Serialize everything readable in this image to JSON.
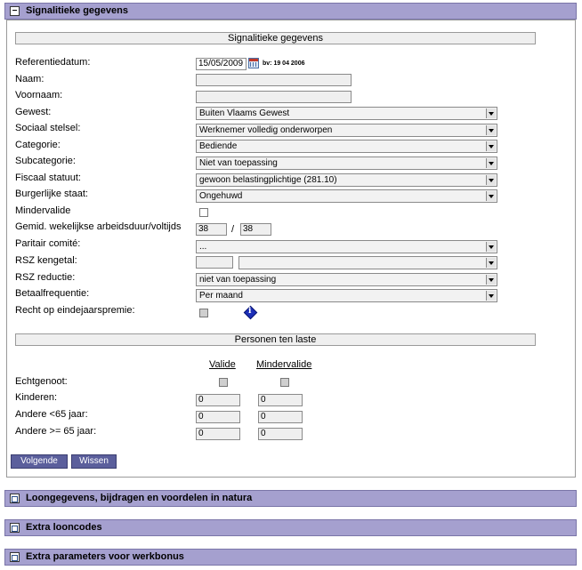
{
  "panels": [
    {
      "title": "Signalitieke gegevens",
      "toggle": "−"
    },
    {
      "title": "Loongegevens, bijdragen en voordelen in natura"
    },
    {
      "title": "Extra looncodes"
    },
    {
      "title": "Extra parameters voor werkbonus"
    }
  ],
  "section1_title": "Signalitieke gegevens",
  "section2_title": "Personen ten laste",
  "fields": {
    "referentiedatum": {
      "label": "Referentiedatum:",
      "value": "15/05/2009",
      "hint": "bv: 19 04 2006"
    },
    "naam": {
      "label": "Naam:",
      "value": ""
    },
    "voornaam": {
      "label": "Voornaam:",
      "value": ""
    },
    "gewest": {
      "label": "Gewest:",
      "value": "Buiten Vlaams Gewest"
    },
    "sociaal_stelsel": {
      "label": "Sociaal stelsel:",
      "value": "Werknemer volledig onderworpen"
    },
    "categorie": {
      "label": "Categorie:",
      "value": "Bediende"
    },
    "subcategorie": {
      "label": "Subcategorie:",
      "value": "Niet van toepassing"
    },
    "fiscaal_statuut": {
      "label": "Fiscaal statuut:",
      "value": "gewoon belastingplichtige (281.10)"
    },
    "burgerlijke_staat": {
      "label": "Burgerlijke staat:",
      "value": "Ongehuwd"
    },
    "mindervalide": {
      "label": "Mindervalide",
      "checked": false
    },
    "arbeidsduur": {
      "label": "Gemid. wekelijkse arbeidsduur/voltijds",
      "value1": "38",
      "separator": "/",
      "value2": "38"
    },
    "paritair_comite": {
      "label": "Paritair comité:",
      "value": "..."
    },
    "rsz_kengetal": {
      "label": "RSZ kengetal:",
      "value1": "",
      "value2": ""
    },
    "rsz_reductie": {
      "label": "RSZ reductie:",
      "value": "niet van toepassing"
    },
    "betaalfrequentie": {
      "label": "Betaalfrequentie:",
      "value": "Per maand"
    },
    "eindejaarspremie": {
      "label": "Recht op eindejaarspremie:",
      "checked": false
    }
  },
  "personen": {
    "col_valide": "Valide",
    "col_mindervalide": "Mindervalide",
    "rows": [
      {
        "label": "Echtgenoot:",
        "type": "checkbox"
      },
      {
        "label": "Kinderen:",
        "valide": "0",
        "mindervalide": "0"
      },
      {
        "label": "Andere <65 jaar:",
        "valide": "0",
        "mindervalide": "0"
      },
      {
        "label": "Andere >= 65 jaar:",
        "valide": "0",
        "mindervalide": "0"
      }
    ]
  },
  "buttons": {
    "next": "Volgende",
    "clear": "Wissen"
  },
  "colors": {
    "header": "#a5a0cf",
    "button": "#5b5f9c",
    "info_icon": "#1c2fb8"
  }
}
